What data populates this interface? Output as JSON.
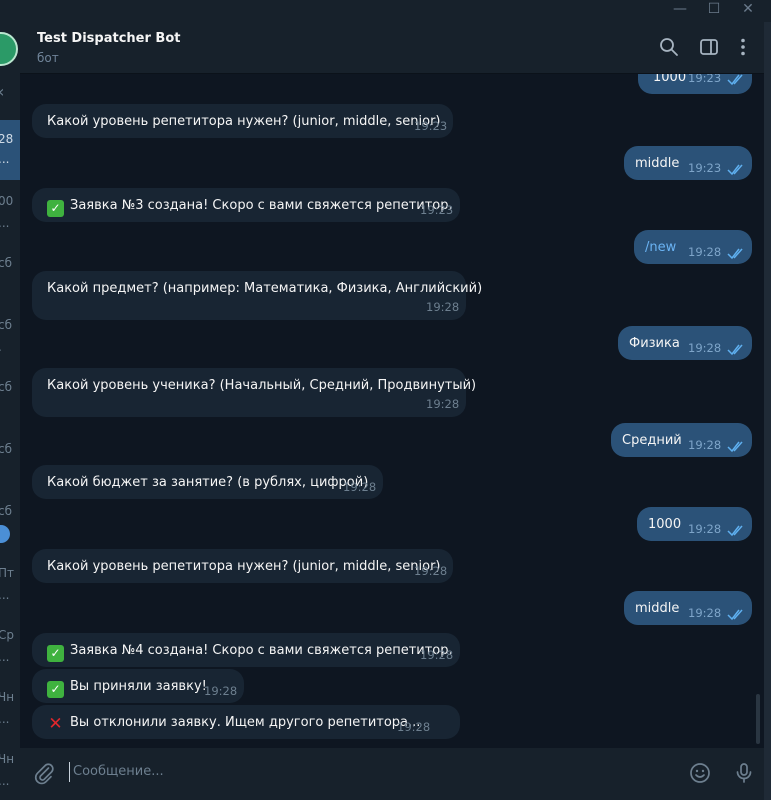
{
  "window": {
    "minimize_glyph": "—",
    "maximize_glyph": "☐",
    "close_glyph": "✕"
  },
  "sidebar": {
    "fragments": [
      "28",
      "...",
      "00",
      "...",
      "сб",
      "сб",
      ".",
      "сб",
      "сб",
      "сб",
      "Пт",
      "...",
      "Ср",
      "...",
      "Чн",
      "...",
      "Чн",
      "..."
    ]
  },
  "header": {
    "title": "Test Dispatcher Bot",
    "subtitle": "бот",
    "icons": [
      "search-icon",
      "sidebar-toggle-icon",
      "more-vertical-icon"
    ]
  },
  "messages": [
    {
      "dir": "out",
      "text": "1000",
      "time": "19:23"
    },
    {
      "dir": "in",
      "text": "Какой уровень репетитора нужен? (junior, middle, senior)",
      "time": "19:23"
    },
    {
      "dir": "out",
      "text": "middle",
      "time": "19:23"
    },
    {
      "dir": "in",
      "emoji": "check-mark-icon",
      "text": "Заявка №3 создана! Скоро с вами свяжется репетитор.",
      "time": "19:23"
    },
    {
      "dir": "out",
      "text": "/new",
      "time": "19:28"
    },
    {
      "dir": "in",
      "text": "Какой предмет? (например: Математика, Физика, Английский)",
      "time": "19:28"
    },
    {
      "dir": "out",
      "text": "Физика",
      "time": "19:28"
    },
    {
      "dir": "in",
      "text": "Какой уровень ученика? (Начальный, Средний, Продвинутый)",
      "time": "19:28"
    },
    {
      "dir": "out",
      "text": "Средний",
      "time": "19:28"
    },
    {
      "dir": "in",
      "text": "Какой бюджет за занятие? (в рублях, цифрой)",
      "time": "19:28"
    },
    {
      "dir": "out",
      "text": "1000",
      "time": "19:28"
    },
    {
      "dir": "in",
      "text": "Какой уровень репетитора нужен? (junior, middle, senior)",
      "time": "19:28"
    },
    {
      "dir": "out",
      "text": "middle",
      "time": "19:28"
    },
    {
      "dir": "in",
      "emoji": "check-mark-icon",
      "text": "Заявка №4 создана! Скоро с вами свяжется репетитор.",
      "time": "19:28"
    },
    {
      "dir": "in",
      "emoji": "check-mark-icon",
      "text": "Вы приняли заявку!",
      "time": "19:28"
    },
    {
      "dir": "in",
      "emoji": "cross-mark-icon",
      "text": "Вы отклонили заявку. Ищем другого репетитора...",
      "time": "19:28"
    }
  ],
  "composer": {
    "placeholder": "Сообщение...",
    "icons": [
      "attach-icon",
      "emoji-icon",
      "microphone-icon"
    ]
  },
  "colors": {
    "background": "#0e1621",
    "panel": "#17212b",
    "incoming_bubble": "#182533",
    "outgoing_bubble": "#2b5278",
    "accent": "#6ab3f3",
    "check_green": "#3fb23f",
    "cross_red": "#e0272c"
  }
}
